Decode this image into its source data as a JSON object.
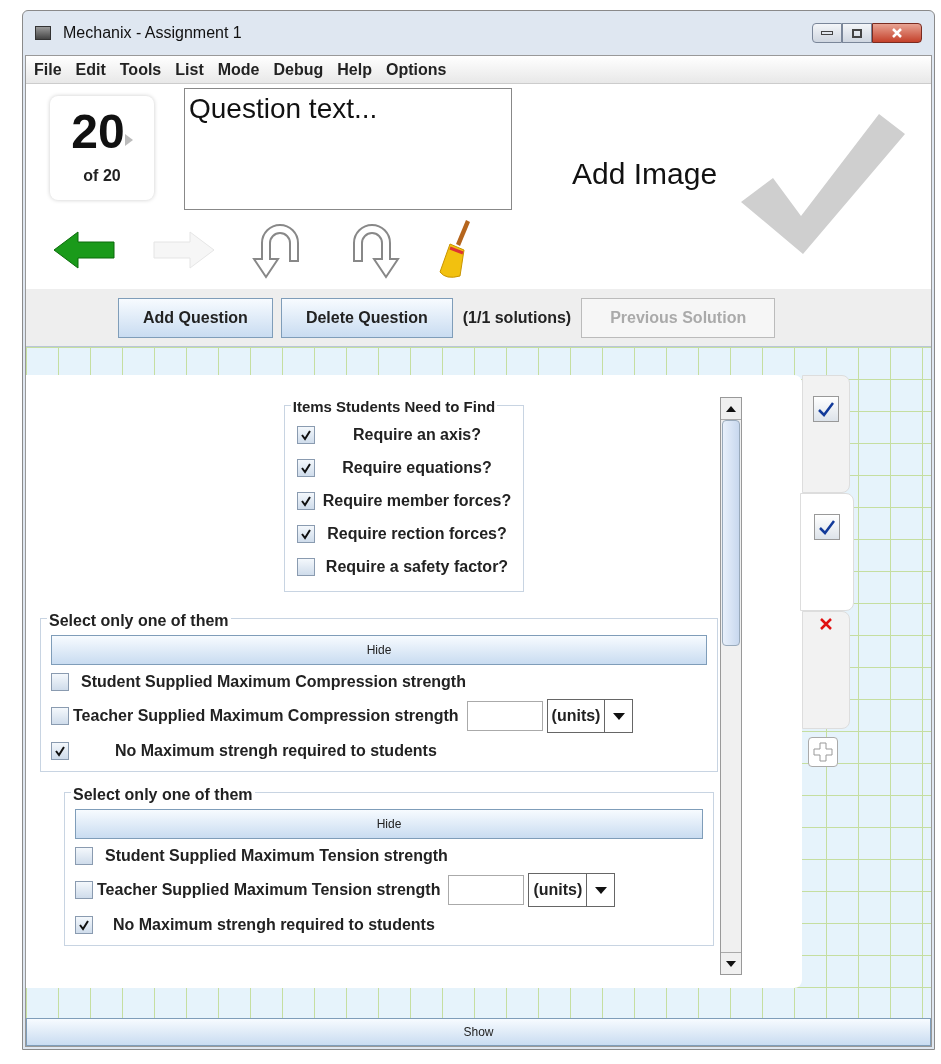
{
  "window": {
    "title": "Mechanix - Assignment 1"
  },
  "menu": [
    "File",
    "Edit",
    "Tools",
    "List",
    "Mode",
    "Debug",
    "Help",
    "Options"
  ],
  "question": {
    "number": "20",
    "total": "of 20",
    "text": "Question text...",
    "add_image": "Add Image"
  },
  "toolbar": [
    {
      "kind": "back",
      "disabled": false
    },
    {
      "kind": "forward",
      "disabled": true
    },
    {
      "kind": "undo",
      "disabled": false
    },
    {
      "kind": "redo",
      "disabled": false
    },
    {
      "kind": "clear",
      "disabled": false
    }
  ],
  "buttons": [
    {
      "label": "Add Question",
      "disabled": false
    },
    {
      "label": "Delete Question",
      "disabled": false
    }
  ],
  "solutions": "(1/1 solutions)",
  "previous_solution": {
    "label": "Previous Solution",
    "disabled": true
  },
  "items_panel": {
    "title": "Items Students Need to Find",
    "items": [
      {
        "label": "Require an axis?",
        "checked": true
      },
      {
        "label": "Require equations?",
        "checked": true
      },
      {
        "label": "Require member forces?",
        "checked": true
      },
      {
        "label": "Require rection forces?",
        "checked": true
      },
      {
        "label": "Require a safety factor?",
        "checked": false
      }
    ]
  },
  "groups": [
    {
      "title": "Select only one of them",
      "hide": "Hide",
      "options": [
        {
          "kind": "plain",
          "label": "Student Supplied Maximum Compression strength",
          "checked": false
        },
        {
          "kind": "units",
          "label": "Teacher Supplied Maximum Compression strength",
          "checked": false,
          "units": "(units)"
        },
        {
          "kind": "plain",
          "label": "No Maximum strengh required to students",
          "checked": true
        }
      ]
    },
    {
      "title": "Select only one of them",
      "hide": "Hide",
      "options": [
        {
          "kind": "plain",
          "label": "Student Supplied Maximum Tension strength",
          "checked": false
        },
        {
          "kind": "units",
          "label": "Teacher Supplied Maximum Tension strength",
          "checked": false,
          "units": "(units)"
        },
        {
          "kind": "plain",
          "label": "No Maximum strengh required to students",
          "checked": true
        }
      ]
    }
  ],
  "side_tabs": [
    {
      "kind": "check",
      "selected": false
    },
    {
      "kind": "check",
      "selected": true
    },
    {
      "kind": "delete",
      "selected": false
    }
  ],
  "show": "Show"
}
